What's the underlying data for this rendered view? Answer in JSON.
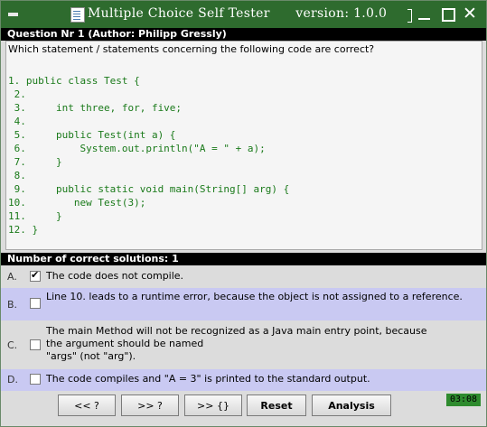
{
  "window": {
    "title": "Multiple Choice Self Tester      version: 1.0.0",
    "controls": {
      "system_icon": "window-menu-icon",
      "app_icon": "document-icon",
      "minimize_icon": "minimize-icon",
      "maximize_icon": "maximize-icon",
      "close_icon": "close-icon",
      "close_glyph": "✕"
    }
  },
  "question": {
    "header": "Question Nr 1 (Author: Philipp Gressly)",
    "intro": "Which statement / statements concerning the following code are correct?",
    "code_lines": [
      "1. public class Test {",
      " 2.",
      " 3.     int three, for, five;",
      " 4.",
      " 5.     public Test(int a) {",
      " 6.         System.out.println(\"A = \" + a);",
      " 7.     }",
      " 8.",
      " 9.     public static void main(String[] arg) {",
      "10.        new Test(3);",
      "11.     }",
      "12. }"
    ]
  },
  "solutions": {
    "header": "Number of correct solutions: 1",
    "answers": [
      {
        "letter": "A.",
        "text": "The code does not compile.",
        "checked": true
      },
      {
        "letter": "B.",
        "text": "Line 10. leads to a runtime error, because the object is not assigned to a reference.",
        "checked": false
      },
      {
        "letter": "C.",
        "text_lines": [
          "The main Method will not be recognized as a Java main entry point, because",
          "the argument should be named",
          "\"args\" (not \"arg\")."
        ],
        "checked": false
      },
      {
        "letter": "D.",
        "text": "The code compiles and \"A = 3\" is printed to the standard output.",
        "checked": false
      }
    ]
  },
  "toolbar": {
    "first_label": "<< ?",
    "next_label": ">> ?",
    "next_unanswered_label": ">> {}",
    "reset_label": "Reset",
    "analysis_label": "Analysis",
    "timer": "03:08"
  },
  "colors": {
    "titlebar": "#2e6b2e",
    "code_text": "#1a7a1a",
    "answer_highlight": "#c9c9f2",
    "timer_bg": "#2e8b2e"
  }
}
